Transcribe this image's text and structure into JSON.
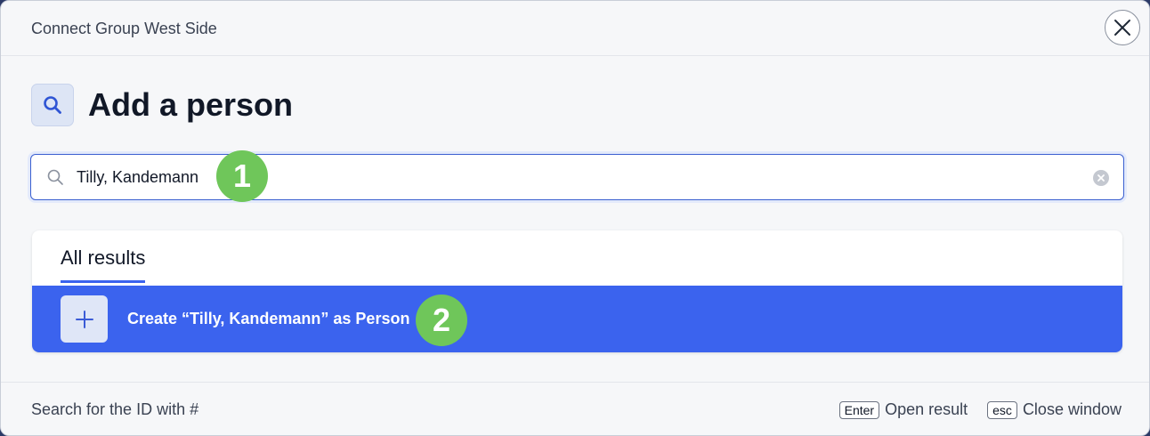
{
  "header": {
    "title": "Connect Group West Side",
    "close_icon": "close-icon"
  },
  "page": {
    "title": "Add a person",
    "icon": "search-icon"
  },
  "search": {
    "value": "Tilly, Kandemann",
    "icon": "search-icon",
    "clear_icon": "clear-icon"
  },
  "annotations": {
    "step1": "1",
    "step2": "2",
    "color": "#6fc65a"
  },
  "results": {
    "tabs": [
      {
        "label": "All results",
        "active": true
      }
    ],
    "items": [
      {
        "label": "Create “Tilly, Kandemann” as Person",
        "icon": "plus-icon",
        "selected": true
      }
    ]
  },
  "footer": {
    "hint": "Search for the ID with #",
    "shortcuts": [
      {
        "key": "Enter",
        "label": "Open result"
      },
      {
        "key": "esc",
        "label": "Close window"
      }
    ]
  },
  "colors": {
    "accent": "#3b63ee",
    "background": "#f6f7f9"
  }
}
